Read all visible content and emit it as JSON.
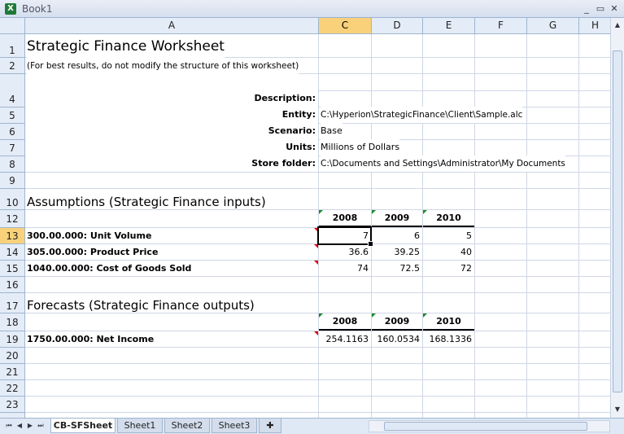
{
  "window": {
    "title": "Book1"
  },
  "columns": [
    "A",
    "C",
    "D",
    "E",
    "F",
    "G",
    "H"
  ],
  "rows": [
    "1",
    "2",
    "4",
    "5",
    "6",
    "7",
    "8",
    "9",
    "10",
    "12",
    "13",
    "14",
    "15",
    "16",
    "17",
    "18",
    "19",
    "20",
    "21",
    "22",
    "23"
  ],
  "sheet": {
    "title": "Strategic Finance Worksheet",
    "subtitle": "(For best results, do not modify the structure of this worksheet)",
    "fields": [
      {
        "label": "Description:",
        "value": ""
      },
      {
        "label": "Entity:",
        "value": "C:\\Hyperion\\StrategicFinance\\Client\\Sample.alc"
      },
      {
        "label": "Scenario:",
        "value": "Base"
      },
      {
        "label": "Units:",
        "value": "Millions of Dollars"
      },
      {
        "label": "Store folder:",
        "value": "C:\\Documents and Settings\\Administrator\\My Documents"
      }
    ],
    "assumptions": {
      "heading": "Assumptions (Strategic Finance inputs)",
      "years": [
        "2008",
        "2009",
        "2010"
      ],
      "rows": [
        {
          "label": "300.00.000: Unit Volume",
          "values": [
            "7",
            "6",
            "5"
          ]
        },
        {
          "label": "305.00.000: Product Price",
          "values": [
            "36.6",
            "39.25",
            "40"
          ]
        },
        {
          "label": "1040.00.000: Cost of Goods Sold",
          "values": [
            "74",
            "72.5",
            "72"
          ]
        }
      ]
    },
    "forecasts": {
      "heading": "Forecasts (Strategic Finance outputs)",
      "years": [
        "2008",
        "2009",
        "2010"
      ],
      "rows": [
        {
          "label": "1750.00.000: Net Income",
          "values": [
            "254.1163",
            "160.0534",
            "168.1336"
          ]
        }
      ]
    }
  },
  "tabs": [
    "CB-SFSheet",
    "Sheet1",
    "Sheet2",
    "Sheet3"
  ],
  "colors": {
    "header_bg": "#e4ecf7",
    "selected_header": "#f8d17a",
    "green_marker": "#1a8a2e",
    "red_marker": "#dd0000"
  }
}
